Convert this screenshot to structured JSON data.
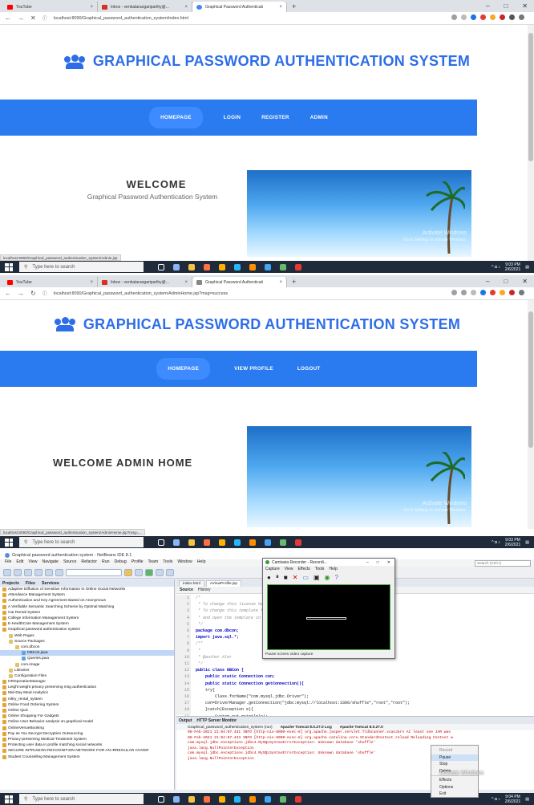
{
  "browser": {
    "tabs": [
      {
        "title": "YouTube",
        "color": "#ff0000"
      },
      {
        "title": "Inbox - venkataraogariparthy@...",
        "color": "#d93025"
      },
      {
        "title": "Graphical Password Authenticati",
        "color": "#4285f4"
      }
    ],
    "tabs2_third": "Graphical Password Authenticati",
    "new_tab": "+",
    "url1": "localhost:8090/Graphical_password_authentication_system/index.html",
    "url2": "localhost:8090/Graphical_password_authentication_system/AdminHome.jsp?msg=success",
    "status1": "localhost:8090/Graphical_password_authentication_system/Admin.jsp",
    "status2": "localhost:8090/Graphical_password_authentication_system/AdminHome.jsp?msg=..."
  },
  "site": {
    "title": "GRAPHICAL PASSWORD AUTHENTICATION SYSTEM",
    "nav1": [
      "HOMEPAGE",
      "LOGIN",
      "REGISTER",
      "ADMIN"
    ],
    "nav2": [
      "HOMEPAGE",
      "VIEW PROFILE",
      "LOGOUT"
    ],
    "welcome": "WELCOME",
    "welcome_sub": "Graphical Password Authentication System",
    "admin_welcome": "WELCOME ADMIN HOME",
    "watermark": "Activate Windows",
    "watermark_sub": "Go to Settings to activate Windows."
  },
  "taskbar": {
    "search_placeholder": "Type here to search",
    "time": "9:03 PM",
    "date": "2/6/2021",
    "time3": "9:04 PM"
  },
  "ide": {
    "title": "Graphical password authentication system - NetBeans IDE 8.1",
    "menu": [
      "File",
      "Edit",
      "View",
      "Navigate",
      "Source",
      "Refactor",
      "Run",
      "Debug",
      "Profile",
      "Team",
      "Tools",
      "Window",
      "Help"
    ],
    "search_placeholder": "Search (Ctrl+I)",
    "panel_tabs": [
      "Projects",
      "Files",
      "Services"
    ],
    "projects": [
      {
        "label": "Adaptive Diffusion of Sensitive Information In Online Social Networks",
        "type": "proj",
        "indent": 0
      },
      {
        "label": "Attendance Management System",
        "type": "proj",
        "indent": 0
      },
      {
        "label": "Authentication and Key Agreement Based on Anonymous",
        "type": "proj",
        "indent": 0
      },
      {
        "label": "A Verifiable Semantic Searching Scheme by Optimal Matching",
        "type": "proj",
        "indent": 0
      },
      {
        "label": "Car Rental System",
        "type": "proj",
        "indent": 0
      },
      {
        "label": "College Information Management System",
        "type": "proj",
        "indent": 0
      },
      {
        "label": "E-HealthCare Management System",
        "type": "proj",
        "indent": 0
      },
      {
        "label": "Graphical password authentication system",
        "type": "proj",
        "indent": 0
      },
      {
        "label": "Web Pages",
        "type": "pkg",
        "indent": 1
      },
      {
        "label": "Source Packages",
        "type": "pkg",
        "indent": 1
      },
      {
        "label": "com.dbcon",
        "type": "pkg",
        "indent": 2
      },
      {
        "label": "DBCon.java",
        "type": "file",
        "indent": 3,
        "selected": true
      },
      {
        "label": "Queries.java",
        "type": "file",
        "indent": 3
      },
      {
        "label": "com.image",
        "type": "pkg",
        "indent": 2
      },
      {
        "label": "Libraries",
        "type": "pkg",
        "indent": 1
      },
      {
        "label": "Configuration Files",
        "type": "pkg",
        "indent": 1
      },
      {
        "label": "HROperationManager",
        "type": "proj",
        "indent": 0
      },
      {
        "label": "Leight weight privacy preserving msg authentication",
        "type": "proj",
        "indent": 0
      },
      {
        "label": "Mid-Day Meal Analytics",
        "type": "proj",
        "indent": 0
      },
      {
        "label": "mltry_rental_system",
        "type": "proj",
        "indent": 0
      },
      {
        "label": "Online Food Ordering System",
        "type": "proj",
        "indent": 0
      },
      {
        "label": "Online Quiz",
        "type": "proj",
        "indent": 0
      },
      {
        "label": "Online Shopping For Gadgets",
        "type": "proj",
        "indent": 0
      },
      {
        "label": "Online User Behavior analysis on graphical model",
        "type": "proj",
        "indent": 0
      },
      {
        "label": "OnlineVenueBooking",
        "type": "proj",
        "indent": 0
      },
      {
        "label": "Pay as You Decrypt Decryption Outsourcing",
        "type": "proj",
        "indent": 0
      },
      {
        "label": "Privacy-preserving Medical Treatment System",
        "type": "proj",
        "indent": 0
      },
      {
        "label": "Protecting user data in profile matching social networks",
        "type": "proj",
        "indent": 0
      },
      {
        "label": "SECURE INTRUSION RECOGNITION NETWORK FOR AN IRREGULAR COVER",
        "type": "proj",
        "indent": 0
      },
      {
        "label": "Student Counselling Management System",
        "type": "proj",
        "indent": 0
      }
    ],
    "editor_tabs": [
      "index.html",
      "AViewProfile.jsp"
    ],
    "editor_modes": [
      "Source",
      "History"
    ],
    "code_lines": [
      "1",
      "2",
      "3",
      "4",
      "5",
      "6",
      "7",
      "8",
      "9",
      "10",
      "11",
      "12",
      "13",
      "14",
      "15",
      "16",
      "17",
      "18",
      "19"
    ],
    "code": [
      "/*",
      " * To change this license header, choose License Headers in Project Properties.",
      " * To change this template file, choose Tools | Templates",
      " * and open the template in the editor.",
      " */",
      "package com.dbcon;",
      "import java.sql.*;",
      "/**",
      " *",
      " * @author Aler",
      " */",
      "public class DBCon {",
      "    public static Connection con;",
      "    public static Connection getConnection(){",
      "    try{",
      "        Class.forName(\"com.mysql.jdbc.Driver\");",
      "    con=DriverManager.getConnection(\"jdbc:mysql://localhost:3306/shuffle\",\"root\",\"root\");",
      "    }catch(Exception e){",
      "        System.out.println(e);"
    ],
    "output_tabs": [
      "Output",
      "HTTP Server Monitor"
    ],
    "output_sub": [
      "Graphical_password_authentication_system (run)",
      "Apache Tomcat 8.0.27.0 Log",
      "Apache Tomcat 8.0.27.0"
    ],
    "output_lines": [
      "06-Feb-2021 21:04:07.431 INFO [http-nio-8090-exec-8] org.apache.jasper.servlet.TldScanner.scanJars At least one JAR was",
      "06-Feb-2021 21:04:07.433 INFO [http-nio-8090-exec-8] org.apache.catalina.core.StandardContext.reload Reloading Context w",
      "com.mysql.jdbc.exceptions.jdbc4.MySQLSyntaxErrorException: Unknown database 'shuffle'",
      "java.lang.NullPointerException",
      "com.mysql.jdbc.exceptions.jdbc4.MySQLSyntaxErrorException: Unknown database 'shuffle'",
      "java.lang.NullPointerException"
    ]
  },
  "camtasia": {
    "title": "Camtasia Recorder - Recordi...",
    "menu": [
      "Capture",
      "View",
      "Effects",
      "Tools",
      "Help"
    ],
    "status": "Pause screen video capture"
  },
  "context_menu": {
    "items": [
      "Record",
      "Pause",
      "Stop",
      "Delete",
      "Effects",
      "Options",
      "Exit"
    ]
  }
}
